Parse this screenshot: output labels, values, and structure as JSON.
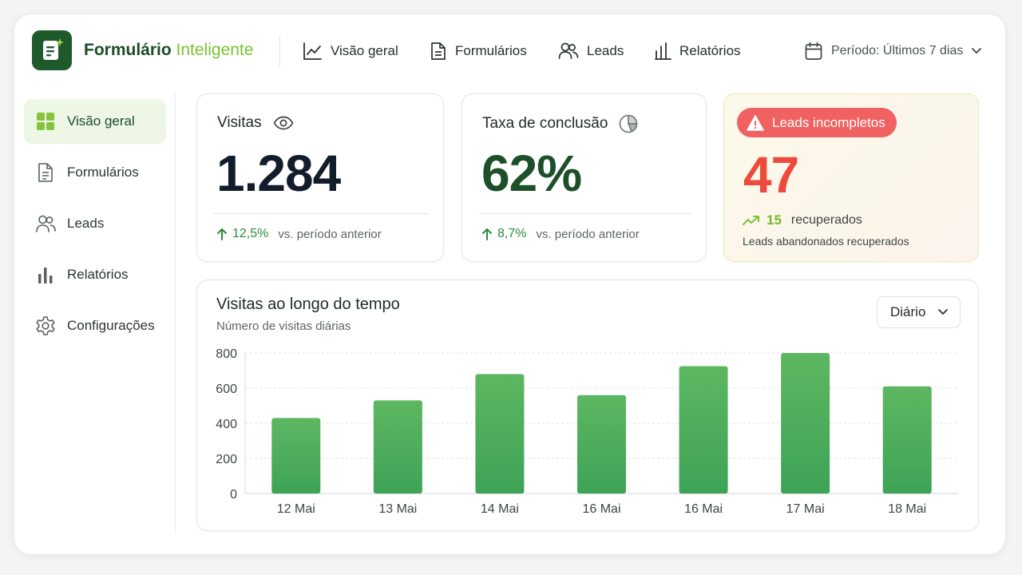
{
  "brand": {
    "name_part1": "Formulário",
    "name_part2": "Inteligente"
  },
  "topnav": [
    {
      "label": "Visão geral",
      "icon": "line-chart-icon"
    },
    {
      "label": "Formulários",
      "icon": "document-icon"
    },
    {
      "label": "Leads",
      "icon": "users-icon"
    },
    {
      "label": "Relatórios",
      "icon": "bar-chart-icon"
    }
  ],
  "period": {
    "label": "Período: Últimos 7 dias",
    "icon": "calendar-icon"
  },
  "sidebar": {
    "items": [
      {
        "label": "Visão geral",
        "icon": "grid-icon",
        "active": true
      },
      {
        "label": "Formulários",
        "icon": "document-icon"
      },
      {
        "label": "Leads",
        "icon": "users-icon"
      },
      {
        "label": "Relatórios",
        "icon": "bar-chart-icon"
      },
      {
        "label": "Configurações",
        "icon": "gear-icon"
      }
    ]
  },
  "cards": {
    "visits": {
      "title": "Visitas",
      "value": "1.284",
      "delta": "12,5%",
      "compare": "vs. período anterior"
    },
    "completion": {
      "title": "Taxa de conclusão",
      "value": "62%",
      "delta": "8,7%",
      "compare": "vs. período anterior"
    },
    "incomplete": {
      "badge": "Leads incompletos",
      "value": "47",
      "recovered_count": "15",
      "recovered_label": "recuperados",
      "note": "Leads abandonados recuperados"
    }
  },
  "chart": {
    "title": "Visitas ao longo do tempo",
    "subtitle": "Número de visitas diárias",
    "granularity": "Diário"
  },
  "colors": {
    "brand_dark": "#1e5a2c",
    "accent_green": "#7cc133",
    "positive": "#2f8a3a",
    "alert": "#f06262",
    "bar_top": "#5db761",
    "bar_bottom": "#3ea356"
  },
  "chart_data": {
    "type": "bar",
    "categories": [
      "12 Mai",
      "13 Mai",
      "14 Mai",
      "16 Mai",
      "16 Mai",
      "17 Mai",
      "18 Mai"
    ],
    "values": [
      430,
      530,
      680,
      560,
      725,
      800,
      610
    ],
    "ylim": [
      0,
      800
    ],
    "yticks": [
      0,
      200,
      400,
      600,
      800
    ],
    "grid": true,
    "title": "Visitas ao longo do tempo",
    "xlabel": "",
    "ylabel": ""
  }
}
